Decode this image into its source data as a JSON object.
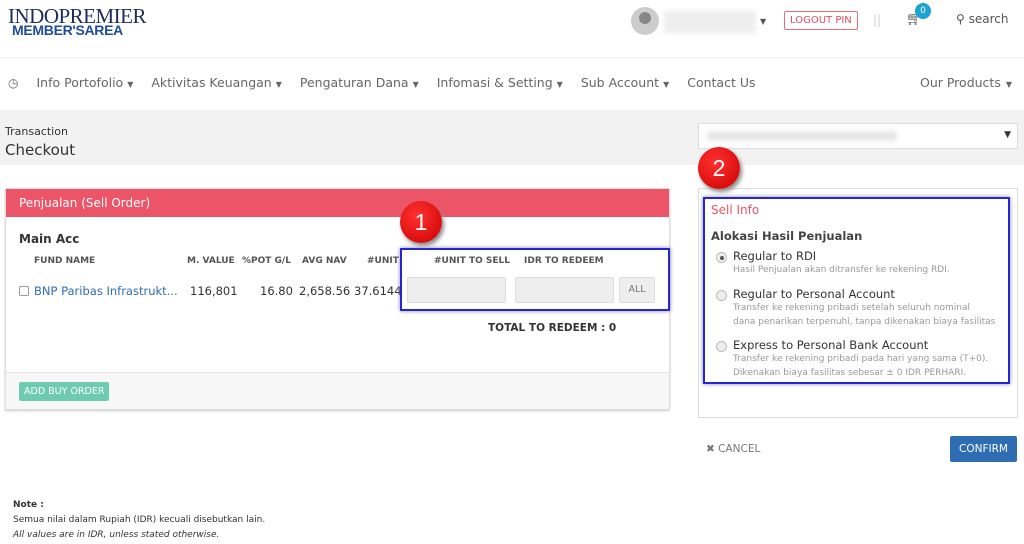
{
  "header": {
    "logo_top": "INDOPREMIER",
    "logo_bottom": "MEMBER'SAREA",
    "logout_pin": "LOGOUT PIN",
    "separator": "||",
    "cart_count": "0",
    "search": "search"
  },
  "nav": {
    "items": [
      "Info Portofolio",
      "Aktivitas Keuangan",
      "Pengaturan Dana",
      "Infomasi & Setting",
      "Sub Account"
    ],
    "contact": "Contact Us",
    "our_products": "Our Products"
  },
  "page": {
    "breadcrumb": "Transaction",
    "title": "Checkout"
  },
  "sell_order": {
    "title": "Penjualan (Sell Order)",
    "account": "Main Acc",
    "columns": [
      "FUND NAME",
      "M. VALUE",
      "%POT G/L",
      "AVG NAV",
      "#UNIT",
      "#UNIT TO SELL",
      "IDR TO REDEEM"
    ],
    "row": {
      "fund": "BNP Paribas Infrastrukt...",
      "m_value": "116,801",
      "pot_gl": "16.80",
      "avg_nav": "2,658.56",
      "unit": "37.6144"
    },
    "all_button": "ALL",
    "total": "TOTAL TO REDEEM : 0",
    "add_buy": "ADD BUY ORDER"
  },
  "annotations": {
    "one": "1",
    "two": "2",
    "highlight_color": "#2525d6"
  },
  "sell_info": {
    "title": "Sell Info",
    "subtitle": "Alokasi Hasil Penjualan",
    "options": [
      {
        "label": "Regular to RDI",
        "desc1": "Hasil Penjualan akan ditransfer ke rekening RDI.",
        "desc2": "",
        "selected": true
      },
      {
        "label": "Regular to Personal Account",
        "desc1": "Transfer ke rekening pribadi setelah seluruh nominal",
        "desc2": "dana penarikan terpenuhi, tanpa dikenakan biaya fasilitas",
        "selected": false
      },
      {
        "label": "Express to Personal Bank Account",
        "desc1": "Transfer ke rekening pribadi pada hari yang sama (T+0).",
        "desc2": "Dikenakan biaya fasilitas sebesar ± 0 IDR PERHARI.",
        "selected": false
      }
    ]
  },
  "actions": {
    "cancel": "CANCEL",
    "confirm": "CONFIRM"
  },
  "note": {
    "title": "Note :",
    "line1": "Semua nilai dalam Rupiah (IDR) kecuali disebutkan lain.",
    "line2": "All values are in IDR, unless stated otherwise."
  },
  "colors": {
    "accent_red": "#ec5468",
    "confirm_blue": "#2f6db3",
    "add_buy_green": "#6ccbb0"
  }
}
